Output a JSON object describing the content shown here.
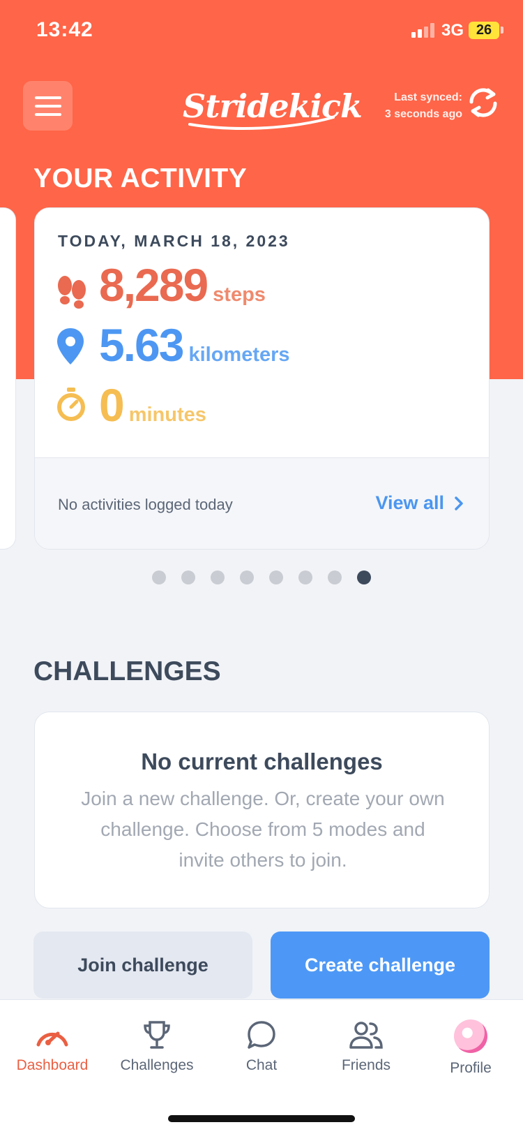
{
  "status_bar": {
    "time": "13:42",
    "network": "3G",
    "battery": "26"
  },
  "header": {
    "app_name": "Stridekick",
    "sync_label": "Last synced:",
    "sync_time": "3 seconds ago",
    "menu_icon": "hamburger-menu-icon",
    "sync_icon": "refresh-icon"
  },
  "activity": {
    "section_title": "YOUR ACTIVITY",
    "date": "TODAY, MARCH 18, 2023",
    "metrics": [
      {
        "value": "8,289",
        "unit": "steps",
        "icon": "footprints-icon",
        "color": "#e96a50"
      },
      {
        "value": "5.63",
        "unit": "kilometers",
        "icon": "location-pin-icon",
        "color": "#4d97f2"
      },
      {
        "value": "0",
        "unit": "minutes",
        "icon": "stopwatch-icon",
        "color": "#f5bd52"
      }
    ],
    "footer_text": "No activities logged today",
    "view_all_label": "View all",
    "pagination": {
      "count": 8,
      "active_index": 7
    }
  },
  "challenges": {
    "section_title": "CHALLENGES",
    "empty_title": "No current challenges",
    "empty_description": "Join a new challenge. Or, create your own challenge. Choose from 5 modes and invite others to join.",
    "join_label": "Join challenge",
    "create_label": "Create challenge"
  },
  "tabs": [
    {
      "label": "Dashboard",
      "icon": "speedometer-icon",
      "active": true
    },
    {
      "label": "Challenges",
      "icon": "trophy-icon",
      "active": false
    },
    {
      "label": "Chat",
      "icon": "chat-bubble-icon",
      "active": false
    },
    {
      "label": "Friends",
      "icon": "people-icon",
      "active": false
    },
    {
      "label": "Profile",
      "icon": "avatar",
      "active": false
    }
  ],
  "colors": {
    "brand": "#ff6548",
    "primary_button": "#4d98f6",
    "text_dark": "#3d4a5c"
  }
}
